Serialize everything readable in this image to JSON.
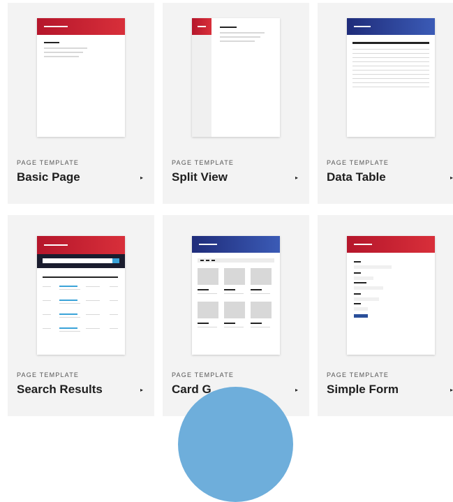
{
  "cards": [
    {
      "label": "PAGE TEMPLATE",
      "name": "Basic Page"
    },
    {
      "label": "PAGE TEMPLATE",
      "name": "Split View"
    },
    {
      "label": "PAGE TEMPLATE",
      "name": "Data Table"
    },
    {
      "label": "PAGE TEMPLATE",
      "name": "Search Results"
    },
    {
      "label": "PAGE TEMPLATE",
      "name": "Card G"
    },
    {
      "label": "PAGE TEMPLATE",
      "name": "Simple Form"
    }
  ],
  "caret": "▸",
  "colors": {
    "card_bg": "#f3f3f3",
    "red_header": "#c81e30",
    "blue_header": "#2a3f98",
    "overlay_circle": "#6eaedb"
  }
}
